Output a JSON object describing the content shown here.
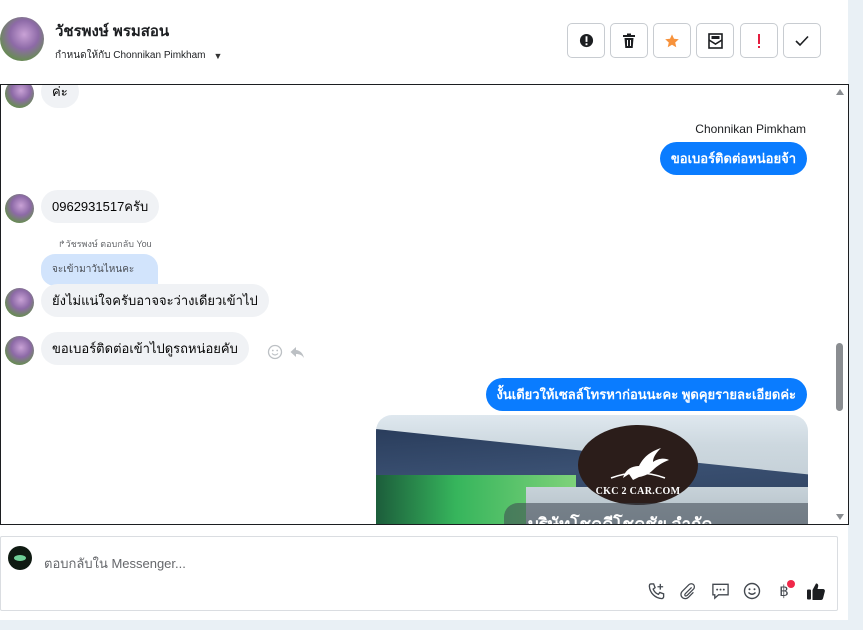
{
  "header": {
    "contact_name": "วัชรพงษ์ พรมสอน",
    "assign_label": "กำหนดให้กับ Chonnikan Pimkham",
    "actions": [
      {
        "icon": "alert-circle-icon"
      },
      {
        "icon": "trash-icon"
      },
      {
        "icon": "star-icon"
      },
      {
        "icon": "mark-unread-icon"
      },
      {
        "icon": "exclamation-icon"
      },
      {
        "icon": "check-icon"
      }
    ]
  },
  "conversation": {
    "messages": [
      {
        "text": "ค่ะ"
      },
      {
        "sender": "Chonnikan Pimkham",
        "text": "ขอเบอร์ติดต่อหน่อยจ้า"
      },
      {
        "text": "0962931517ครับ"
      },
      {
        "reply_label": "↱วัชรพงษ์ ตอบกลับ You",
        "quoted": "จะเข้ามาวันไหนคะ",
        "text": "ยังไม่แน่ใจครับอาจจะว่างเดียวเข้าไป"
      },
      {
        "text": "ขอเบอร์ติดต่อเข้าไปดูรถหน่อยคับ"
      },
      {
        "text": "งั้นเดียวให้เซลล์โทรหาก่อนนะคะ พูดคุยรายละเอียดค่ะ"
      }
    ],
    "attachment": {
      "logo_text": "CKC 2 CAR.COM",
      "banner_text": "บริษัทโชคดีโชคชัย จำกัด"
    }
  },
  "composer": {
    "placeholder": "ตอบกลับใน Messenger...",
    "tools": [
      "call-add-icon",
      "attach-icon",
      "saved-reply-icon",
      "emoji-icon",
      "baht-icon",
      "like-icon"
    ]
  },
  "colors": {
    "outgoing_bubble": "#0a7cff",
    "incoming_bubble": "#f0f2f5",
    "quoted_bubble": "#d2e4fc",
    "star": "#f7923b",
    "exclamation": "#e41e3f",
    "badge": "#f02849"
  }
}
